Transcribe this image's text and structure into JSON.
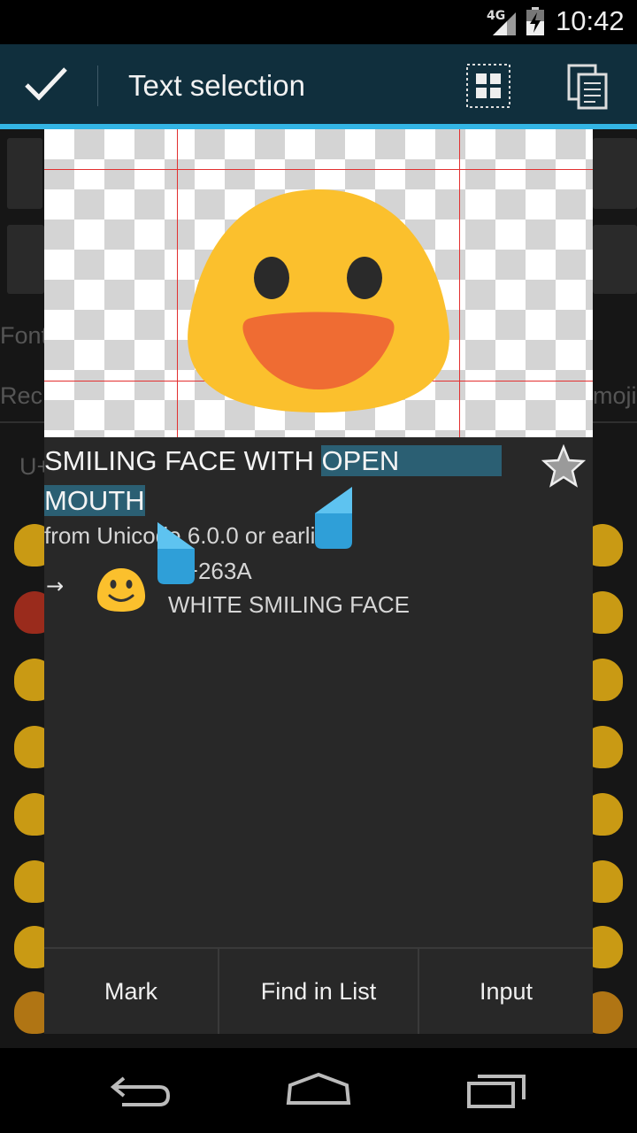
{
  "status_bar": {
    "network": "4G",
    "time": "10:42"
  },
  "action_bar": {
    "title": "Text selection",
    "done_icon": "check-icon",
    "select_all_icon": "select-all-icon",
    "copy_icon": "copy-icon"
  },
  "background": {
    "label_font": "Font",
    "label_recent": "Rec",
    "label_emoji": "moji",
    "field_code": "U+"
  },
  "dialog": {
    "name_plain": "SMILING FACE WITH ",
    "name_selected_1": "OPEN",
    "name_selected_2": "MOUTH",
    "version": "from Unicode 6.0.0 or earlier",
    "arrow": "→",
    "related_code": "U+263A",
    "related_name": "WHITE SMILING FACE",
    "favorite_icon": "star-icon",
    "buttons": {
      "mark": "Mark",
      "find": "Find in List",
      "input": "Input"
    }
  },
  "colors": {
    "action_bar": "#102f3d",
    "accent": "#33b5e5",
    "selection": "#2b5f73",
    "emoji_face": "#fbc02d",
    "emoji_mouth": "#ef6c33"
  }
}
